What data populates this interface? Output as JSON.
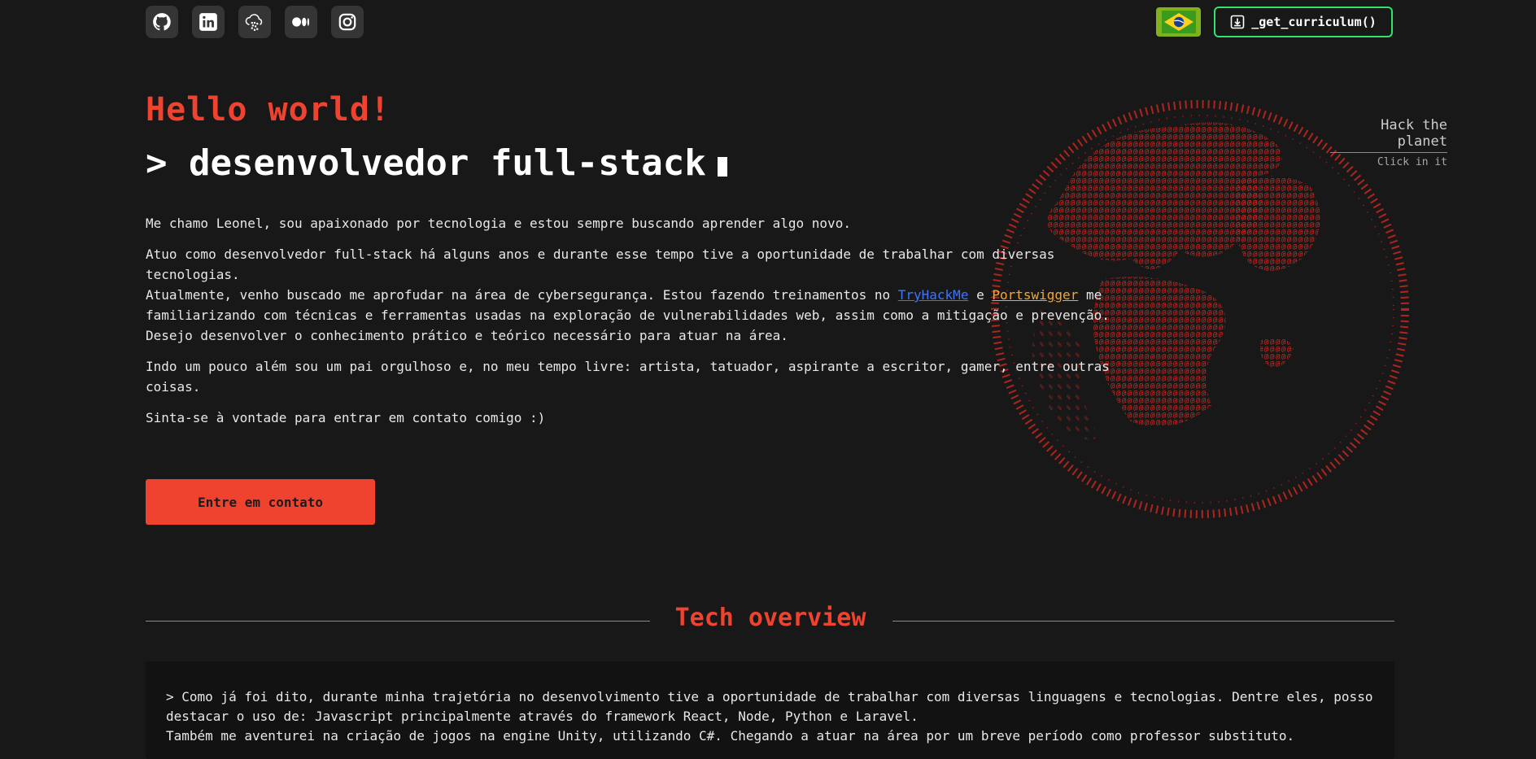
{
  "header": {
    "social": [
      {
        "name": "github-icon",
        "label": "GitHub"
      },
      {
        "name": "linkedin-icon",
        "label": "LinkedIn"
      },
      {
        "name": "cloud-qr-icon",
        "label": "Cloud"
      },
      {
        "name": "medium-icon",
        "label": "Medium"
      },
      {
        "name": "instagram-icon",
        "label": "Instagram"
      }
    ],
    "flag_icon": "brazil-flag-icon",
    "cv_label": "_get_curriculum()",
    "cv_icon": "download-icon"
  },
  "hero": {
    "greeting": "Hello world!",
    "role": "> desenvolvedor full-stack",
    "p1": "Me chamo Leonel, sou apaixonado por tecnologia e estou sempre buscando aprender algo novo.",
    "p2a": "Atuo como desenvolvedor full-stack há alguns anos e durante esse tempo tive a oportunidade de trabalhar com diversas tecnologias.",
    "p2b_pre": "Atualmente, venho buscado me aprofudar na área de cybersegurança. Estou fazendo treinamentos no ",
    "link_tryhackme": "TryHackMe",
    "p2b_mid": " e ",
    "link_portswigger": "Portswigger",
    "p2b_post": " me familiarizando com técnicas e ferramentas usadas na exploração de vulnerabilidades web, assim como a mitigação e prevenção.",
    "p2c": "Desejo desenvolver o conhecimento prático e teórico necessário para atuar na área.",
    "p3": "Indo um pouco além sou um pai orgulhoso e, no meu tempo livre: artista, tatuador, aspirante a escritor, gamer, entre outras coisas.",
    "p4": "Sinta-se à vontade para entrar em contato comigo :)",
    "contact_label": "Entre em contato"
  },
  "globe": {
    "title": "Hack the planet",
    "subtitle": "Click in it",
    "color": "#d42a22"
  },
  "tech": {
    "title": "Tech overview",
    "line1": "> Como já foi dito, durante minha trajetória no desenvolvimento tive a oportunidade de trabalhar com diversas linguagens e tecnologias. Dentre eles, posso destacar o uso de: Javascript principalmente através do framework React, Node, Python e Laravel.",
    "line2": "Também me aventurei na criação de jogos na engine Unity, utilizando C#. Chegando a atuar na área por um breve período como professor substituto."
  },
  "colors": {
    "background": "#181818",
    "accent": "#f0432f",
    "cv_border": "#2fe36c",
    "link_tryhackme": "#3f74ff",
    "link_portswigger": "#f0a830"
  }
}
